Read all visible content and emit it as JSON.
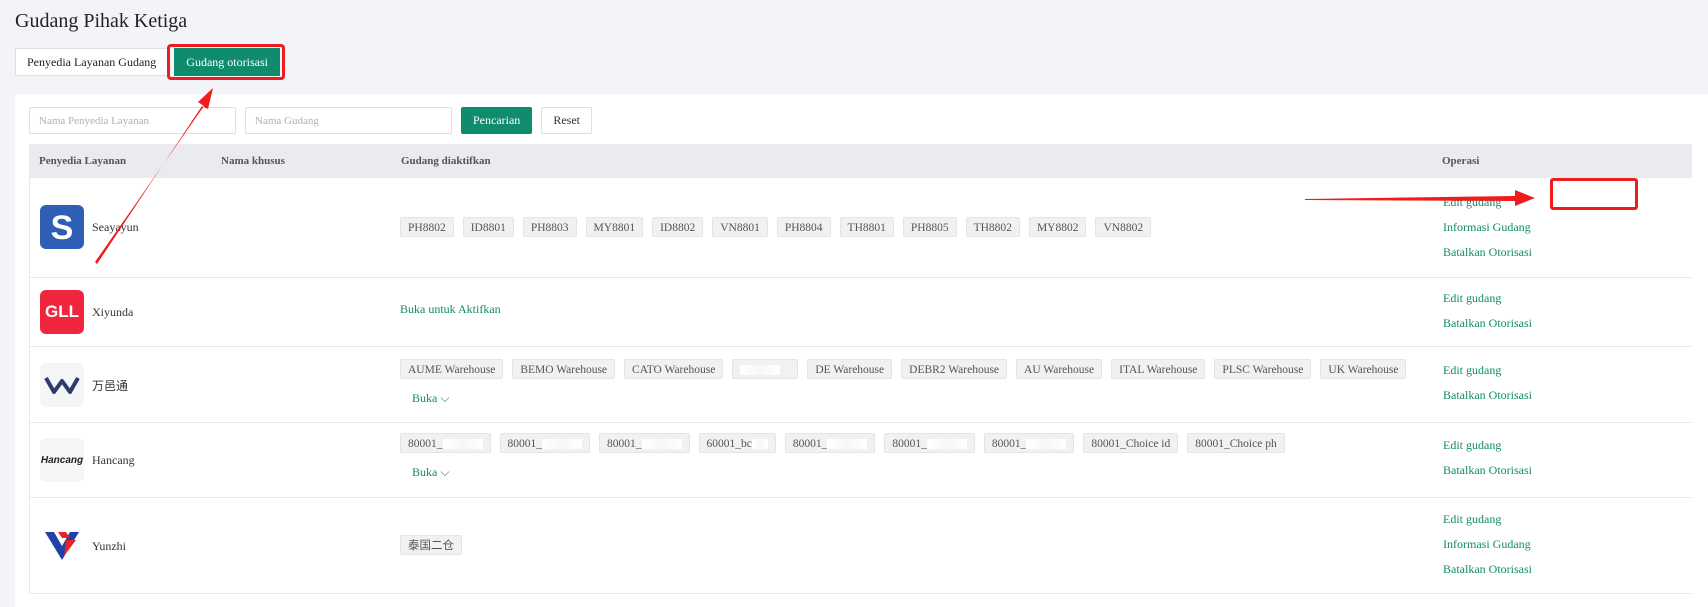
{
  "page": {
    "title": "Gudang Pihak Ketiga"
  },
  "tabs": [
    {
      "label": "Penyedia Layanan Gudang",
      "active": false
    },
    {
      "label": "Gudang otorisasi",
      "active": true
    }
  ],
  "search": {
    "provider_placeholder": "Nama Penyedia Layanan",
    "warehouse_placeholder": "Nama Gudang",
    "search_label": "Pencarian",
    "reset_label": "Reset"
  },
  "table": {
    "headers": {
      "provider": "Penyedia Layanan",
      "custom_name": "Nama khusus",
      "activated": "Gudang diaktifkan",
      "operation": "Operasi"
    },
    "rows": [
      {
        "provider": "Seayayun",
        "logo_icon": "seayayun-s-icon",
        "logo_color": "#2f5fb5",
        "tags": [
          "PH8802",
          "ID8801",
          "PH8803",
          "MY8801",
          "ID8802",
          "VN8801",
          "PH8804",
          "TH8801",
          "PH8805",
          "TH8802",
          "MY8802",
          "VN8802"
        ],
        "ops": [
          "Edit gudang",
          "Informasi Gudang",
          "Batalkan Otorisasi"
        ]
      },
      {
        "provider": "Xiyunda",
        "logo_text": "GLL",
        "logo_color": "#f0263f",
        "activate_link": "Buka untuk Aktifkan",
        "ops": [
          "Edit gudang",
          "Batalkan Otorisasi"
        ]
      },
      {
        "provider": "万邑通",
        "logo_icon": "winit-w-icon",
        "tags": [
          "AUME Warehouse",
          "BEMO Warehouse",
          "CATO Warehouse",
          "",
          "DE Warehouse",
          "DEBR2 Warehouse",
          "AU Warehouse",
          "ITAL Warehouse",
          "PLSC Warehouse",
          "UK Warehouse"
        ],
        "expand": "Buka",
        "ops": [
          "Edit gudang",
          "Batalkan Otorisasi"
        ]
      },
      {
        "provider": "Hancang",
        "logo_text": "Hancang",
        "tags": [
          "80001_",
          "80001_",
          "80001_",
          "60001_bc",
          "80001_",
          "80001_",
          "80001_",
          "80001_Choice id",
          "80001_Choice ph"
        ],
        "expand": "Buka",
        "ops": [
          "Edit gudang",
          "Batalkan Otorisasi"
        ]
      },
      {
        "provider": "Yunzhi",
        "logo_icon": "yunzhi-logo-icon",
        "tags": [
          "泰国二仓"
        ],
        "ops": [
          "Edit gudang",
          "Informasi Gudang",
          "Batalkan Otorisasi"
        ]
      }
    ]
  },
  "colors": {
    "accent": "#0f8b6d",
    "annotation": "#ee1d1d"
  }
}
